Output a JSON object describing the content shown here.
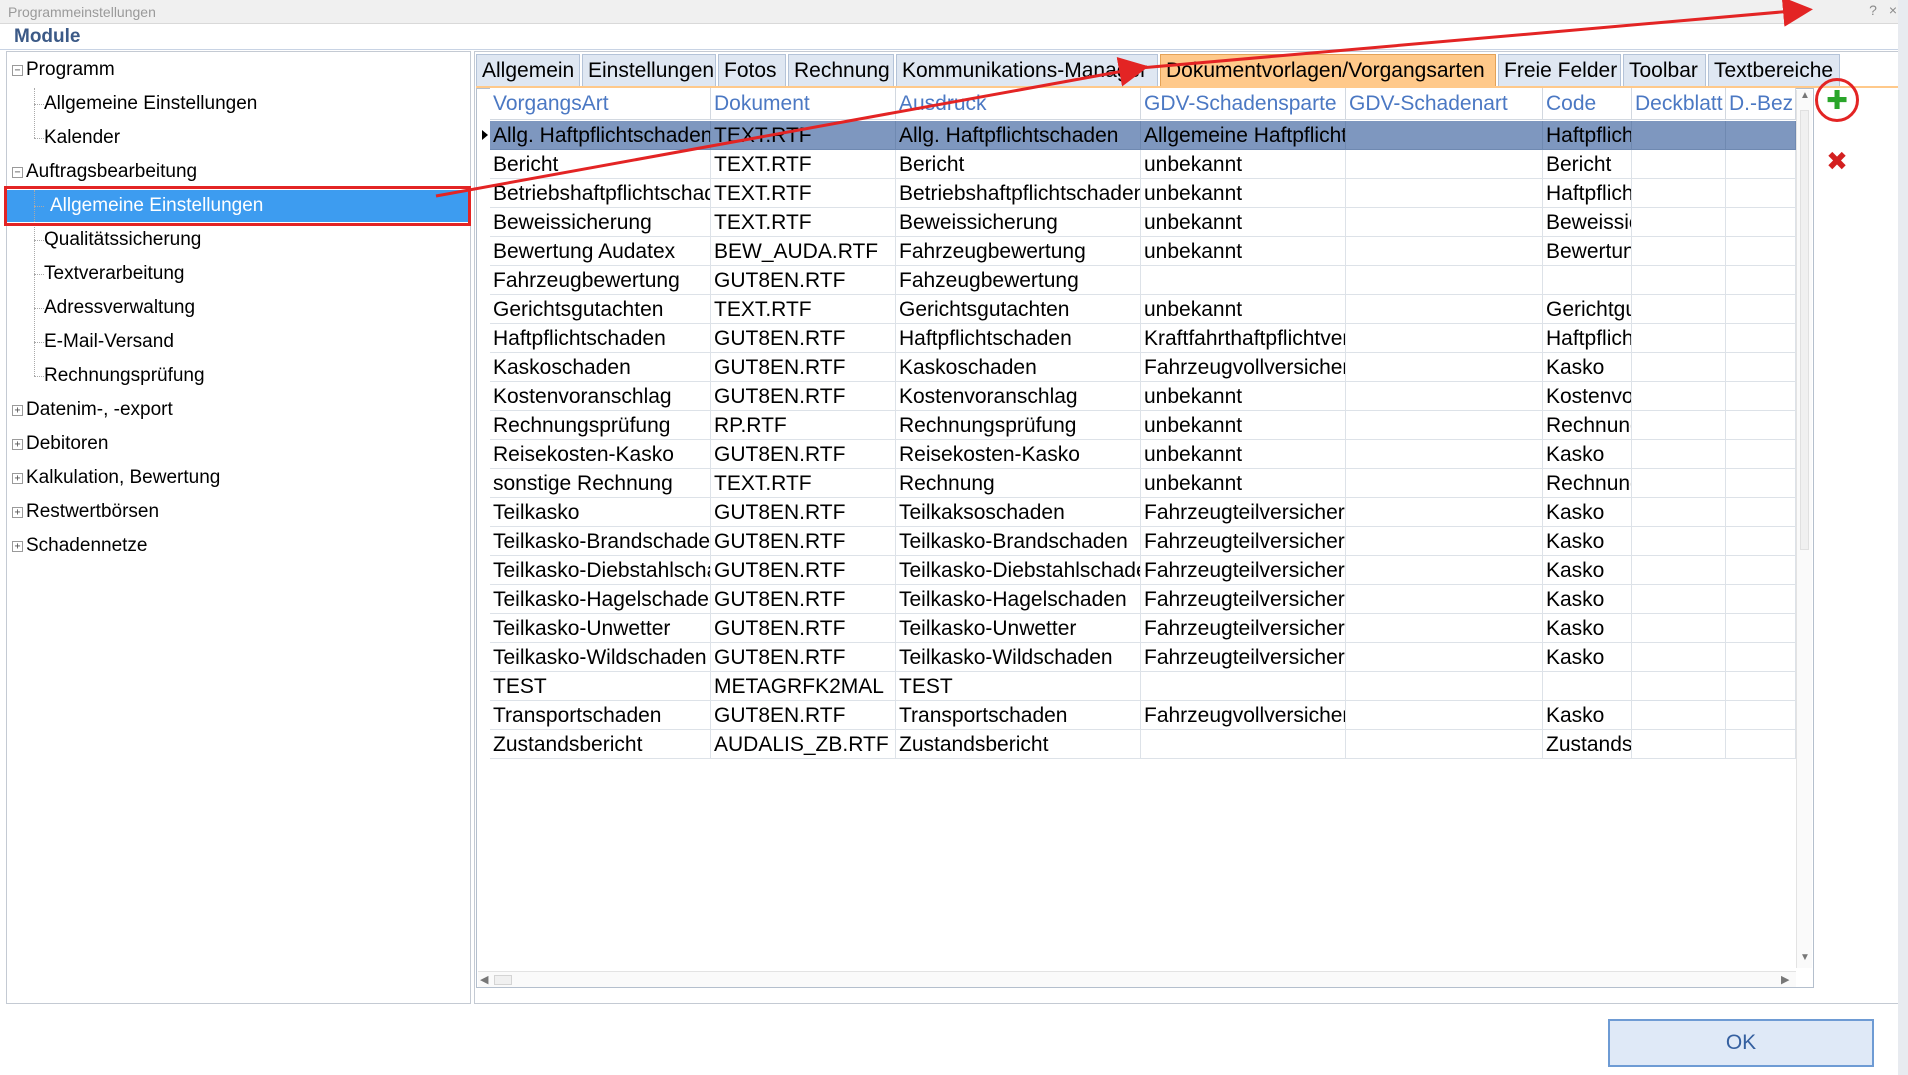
{
  "window": {
    "title": "Programmeinstellungen",
    "help_glyph": "?",
    "close_glyph": "×"
  },
  "module_header": "Module",
  "tree": [
    {
      "label": "Programm",
      "level": 0,
      "expander": "−"
    },
    {
      "label": "Allgemeine Einstellungen",
      "level": 1
    },
    {
      "label": "Kalender",
      "level": 1
    },
    {
      "label": "Auftragsbearbeitung",
      "level": 0,
      "expander": "−"
    },
    {
      "label": "Allgemeine Einstellungen",
      "level": 1,
      "selected": true
    },
    {
      "label": "Qualitätssicherung",
      "level": 1
    },
    {
      "label": "Textverarbeitung",
      "level": 1
    },
    {
      "label": "Adressverwaltung",
      "level": 1
    },
    {
      "label": "E-Mail-Versand",
      "level": 1
    },
    {
      "label": "Rechnungsprüfung",
      "level": 1
    },
    {
      "label": "Datenim-, -export",
      "level": 0,
      "expander": "+"
    },
    {
      "label": "Debitoren",
      "level": 0,
      "expander": "+"
    },
    {
      "label": "Kalkulation, Bewertung",
      "level": 0,
      "expander": "+"
    },
    {
      "label": "Restwertbörsen",
      "level": 0,
      "expander": "+"
    },
    {
      "label": "Schadennetze",
      "level": 0,
      "expander": "+"
    }
  ],
  "tabs": [
    {
      "label": "Allgemein"
    },
    {
      "label": "Einstellungen"
    },
    {
      "label": "Fotos"
    },
    {
      "label": "Rechnung"
    },
    {
      "label": "Kommunikations-Manager"
    },
    {
      "label": "Dokumentvorlagen/Vorgangsarten",
      "active": true
    },
    {
      "label": "Freie Felder"
    },
    {
      "label": "Toolbar"
    },
    {
      "label": "Textbereiche"
    }
  ],
  "grid": {
    "columns": [
      "VorgangsArt",
      "Dokument",
      "Ausdruck",
      "GDV-Schadensparte",
      "GDV-Schadenart",
      "Code",
      "Deckblatt",
      "D.-Bez"
    ],
    "rows": [
      [
        "Allg. Haftpflichtschaden",
        "TEXT.RTF",
        "Allg. Haftpflichtschaden",
        "Allgemeine Haftpflicht",
        "",
        "Haftpflicht",
        "",
        ""
      ],
      [
        "Bericht",
        "TEXT.RTF",
        "Bericht",
        "unbekannt",
        "",
        "Bericht",
        "",
        ""
      ],
      [
        "Betriebshaftpflichtschaden",
        "TEXT.RTF",
        "Betriebshaftpflichtschaden",
        "unbekannt",
        "",
        "Haftpflicht",
        "",
        ""
      ],
      [
        "Beweissicherung",
        "TEXT.RTF",
        "Beweissicherung",
        "unbekannt",
        "",
        "Beweissicherung",
        "",
        ""
      ],
      [
        "Bewertung Audatex",
        "BEW_AUDA.RTF",
        "Fahrzeugbewertung",
        "unbekannt",
        "",
        "Bewertung",
        "",
        ""
      ],
      [
        "Fahrzeugbewertung",
        "GUT8EN.RTF",
        "Fahzeugbewertung",
        "",
        "",
        "",
        "",
        ""
      ],
      [
        "Gerichtsgutachten",
        "TEXT.RTF",
        "Gerichtsgutachten",
        "unbekannt",
        "",
        "Gerichtgutachten",
        "",
        ""
      ],
      [
        "Haftpflichtschaden",
        "GUT8EN.RTF",
        "Haftpflichtschaden",
        "Kraftfahrthaftpflichtversicherung",
        "",
        "Haftpflicht",
        "",
        ""
      ],
      [
        "Kaskoschaden",
        "GUT8EN.RTF",
        "Kaskoschaden",
        "Fahrzeugvollversicherung",
        "",
        "Kasko",
        "",
        ""
      ],
      [
        "Kostenvoranschlag",
        "GUT8EN.RTF",
        "Kostenvoranschlag",
        "unbekannt",
        "",
        "Kostenvoranschlag",
        "",
        ""
      ],
      [
        "Rechnungsprüfung",
        "RP.RTF",
        "Rechnungsprüfung",
        "unbekannt",
        "",
        "Rechnung",
        "",
        ""
      ],
      [
        "Reisekosten-Kasko",
        "GUT8EN.RTF",
        "Reisekosten-Kasko",
        "unbekannt",
        "",
        "Kasko",
        "",
        ""
      ],
      [
        "sonstige Rechnung",
        "TEXT.RTF",
        "Rechnung",
        "unbekannt",
        "",
        "Rechnung",
        "",
        ""
      ],
      [
        "Teilkasko",
        "GUT8EN.RTF",
        "Teilkaksoschaden",
        "Fahrzeugteilversicherung",
        "",
        "Kasko",
        "",
        ""
      ],
      [
        "Teilkasko-Brandschaden",
        "GUT8EN.RTF",
        "Teilkasko-Brandschaden",
        "Fahrzeugteilversicherung",
        "",
        "Kasko",
        "",
        ""
      ],
      [
        "Teilkasko-Diebstahlschaden",
        "GUT8EN.RTF",
        "Teilkasko-Diebstahlschaden",
        "Fahrzeugteilversicherung",
        "",
        "Kasko",
        "",
        ""
      ],
      [
        "Teilkasko-Hagelschaden",
        "GUT8EN.RTF",
        "Teilkasko-Hagelschaden",
        "Fahrzeugteilversicherung",
        "",
        "Kasko",
        "",
        ""
      ],
      [
        "Teilkasko-Unwetter",
        "GUT8EN.RTF",
        "Teilkasko-Unwetter",
        "Fahrzeugteilversicherung",
        "",
        "Kasko",
        "",
        ""
      ],
      [
        "Teilkasko-Wildschaden",
        "GUT8EN.RTF",
        "Teilkasko-Wildschaden",
        "Fahrzeugteilversicherung",
        "",
        "Kasko",
        "",
        ""
      ],
      [
        "TEST",
        "METAGRFK2MAL",
        "TEST",
        "",
        "",
        "",
        "",
        ""
      ],
      [
        "Transportschaden",
        "GUT8EN.RTF",
        "Transportschaden",
        "Fahrzeugvollversicherung",
        "",
        "Kasko",
        "",
        ""
      ],
      [
        "Zustandsbericht",
        "AUDALIS_ZB.RTF",
        "Zustandsbericht",
        "",
        "",
        "Zustandsbericht",
        "",
        ""
      ]
    ],
    "selected_row": 0
  },
  "actions": {
    "add_glyph": "✚",
    "delete_glyph": "✖"
  },
  "ok_label": "OK",
  "scroll": {
    "up": "▲",
    "down": "▼",
    "left": "◀",
    "right": "▶"
  },
  "colors": {
    "selection": "#3d9cf0",
    "active_tab": "#ffc98a",
    "annotation": "#e32424",
    "grid_header_text": "#4b78c3"
  }
}
